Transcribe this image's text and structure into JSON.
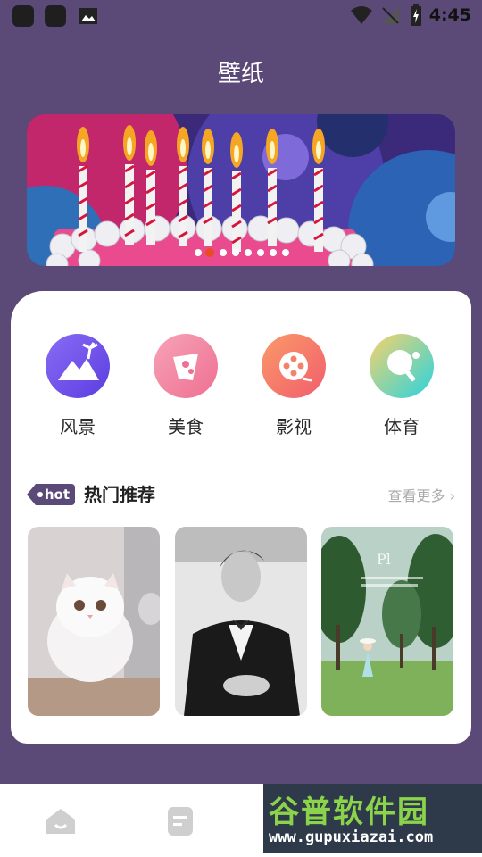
{
  "status_bar": {
    "time": "4:45"
  },
  "header": {
    "title": "壁纸"
  },
  "banner": {
    "dots": 8,
    "active_dot": 1
  },
  "categories": [
    {
      "label": "风景",
      "icon": "mountain-palm-icon",
      "color": "#7b5cf0"
    },
    {
      "label": "美食",
      "icon": "food-icon",
      "color": "#f28fa8"
    },
    {
      "label": "影视",
      "icon": "film-reel-icon",
      "color": "#f4826a"
    },
    {
      "label": "体育",
      "icon": "ping-pong-icon",
      "color": "#36d0d6"
    }
  ],
  "section": {
    "tag": "hot",
    "title": "热门推荐",
    "more": "查看更多 ›"
  },
  "thumbnails": [
    {
      "subject": "white-kitten"
    },
    {
      "subject": "man-in-suit"
    },
    {
      "subject": "girl-in-forest"
    }
  ],
  "watermark": {
    "title": "谷普软件园",
    "url": "www.gupuxiazai.com"
  }
}
